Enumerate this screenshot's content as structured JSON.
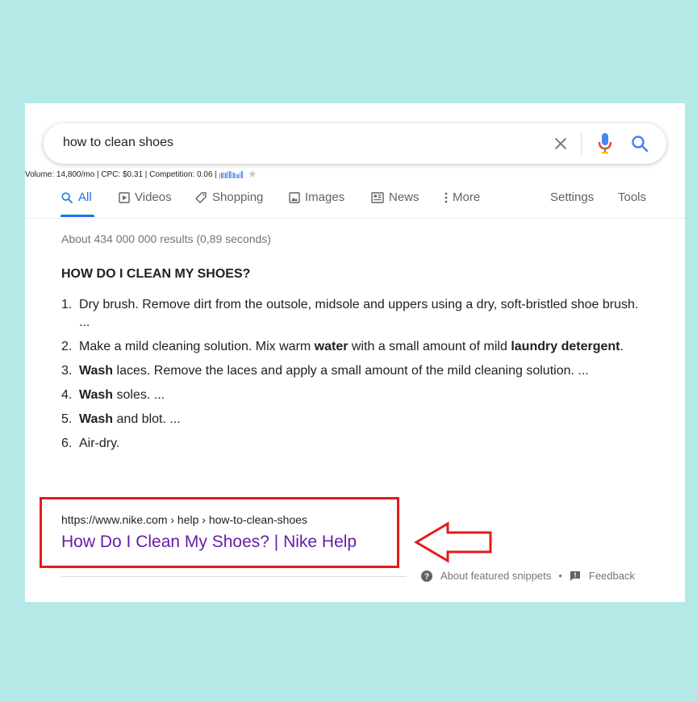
{
  "search": {
    "query": "how to clean shoes"
  },
  "seo_bar": {
    "text": "Volume: 14,800/mo | CPC: $0.31 | Competition: 0.06 |",
    "trend_levels": [
      0.6,
      0.7,
      0.8,
      0.7,
      0.9,
      1.0,
      0.8,
      0.7,
      0.6,
      0.5,
      0.7,
      0.9
    ]
  },
  "tabs": [
    {
      "label": "All",
      "icon": "search-icon",
      "active": true
    },
    {
      "label": "Videos",
      "icon": "video-play-icon"
    },
    {
      "label": "Shopping",
      "icon": "tag-icon"
    },
    {
      "label": "Images",
      "icon": "image-icon"
    },
    {
      "label": "News",
      "icon": "newspaper-icon"
    },
    {
      "label": "More",
      "icon": "vertical-dots-icon"
    }
  ],
  "tools": {
    "settings": "Settings",
    "tools": "Tools"
  },
  "result_stats": "About 434 000 000 results (0,89 seconds)",
  "snippet": {
    "heading": "HOW DO I CLEAN MY SHOES?",
    "steps": [
      {
        "num": "1.",
        "parts": [
          {
            "t": "Dry brush. Remove dirt from the outsole, midsole and uppers using a dry, soft-bristled shoe brush. ..."
          }
        ]
      },
      {
        "num": "2.",
        "parts": [
          {
            "t": "Make a mild cleaning solution. Mix warm "
          },
          {
            "t": "water",
            "b": true
          },
          {
            "t": " with a small amount of mild "
          },
          {
            "t": "laundry detergent",
            "b": true
          },
          {
            "t": "."
          }
        ]
      },
      {
        "num": "3.",
        "parts": [
          {
            "t": "Wash",
            "b": true
          },
          {
            "t": " laces. Remove the laces and apply a small amount of the mild cleaning solution. ..."
          }
        ]
      },
      {
        "num": "4.",
        "parts": [
          {
            "t": "Wash",
            "b": true
          },
          {
            "t": " soles. ..."
          }
        ]
      },
      {
        "num": "5.",
        "parts": [
          {
            "t": "Wash",
            "b": true
          },
          {
            "t": " and blot. ..."
          }
        ]
      },
      {
        "num": "6.",
        "parts": [
          {
            "t": "Air-dry."
          }
        ]
      }
    ],
    "source_url": "https://www.nike.com › help › how-to-clean-shoes",
    "source_title": "How Do I Clean My Shoes? | Nike Help"
  },
  "footer": {
    "about": "About featured snippets",
    "separator": "•",
    "feedback": "Feedback"
  },
  "colors": {
    "page_bg": "#b5e9e8",
    "accent_blue": "#1a73e8",
    "visited_link": "#681da8",
    "highlight_red": "#e21b1b"
  }
}
